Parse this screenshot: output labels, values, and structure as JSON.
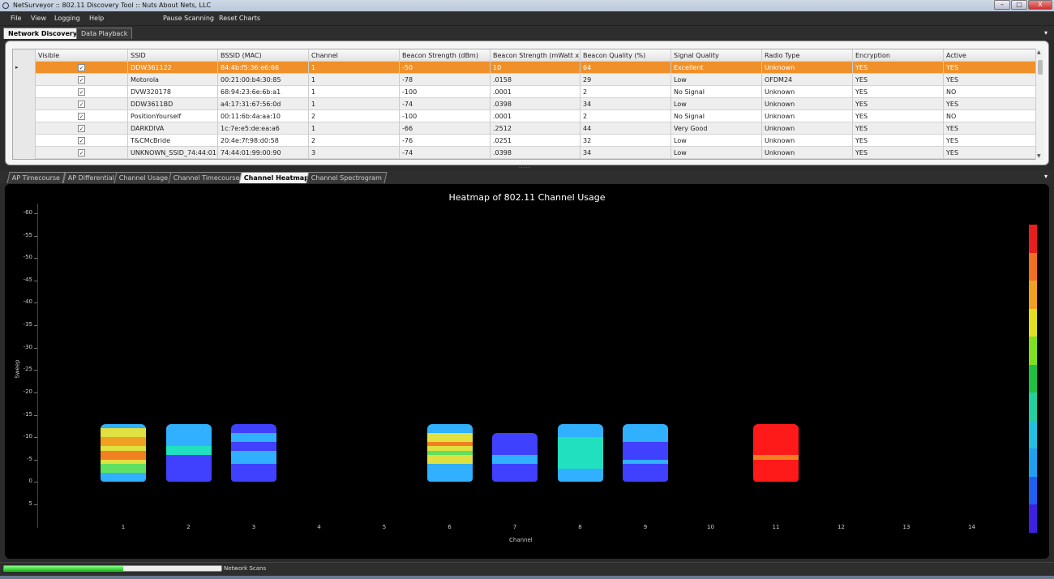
{
  "window": {
    "title": "NetSurveyor :: 802.11 Discovery Tool :: Nuts About Nets, LLC",
    "minimize": "–",
    "maximize": "□",
    "close": "X",
    "icon": "magnifier-icon"
  },
  "menu": {
    "file": "File",
    "view": "View",
    "logging": "Logging",
    "help": "Help",
    "pause": "Pause Scanning",
    "reset": "Reset Charts"
  },
  "top_tabs": [
    {
      "label": "Network Discovery",
      "active": true
    },
    {
      "label": "Data Playback",
      "active": false
    }
  ],
  "grid": {
    "columns": [
      "Visible",
      "SSID",
      "BSSID (MAC)",
      "Channel",
      "Beacon Strength (dBm)",
      "Beacon Strength (mWatt x...",
      "Beacon Quality (%)",
      "Signal Quality",
      "Radio Type",
      "Encryption",
      "Active"
    ],
    "rows": [
      [
        "DDW361122",
        "84:4b:f5:36:e6:66",
        "1",
        "-50",
        "10",
        "64",
        "Excellent",
        "Unknown",
        "YES",
        "YES"
      ],
      [
        "Motorola",
        "00:21:00:b4:30:85",
        "1",
        "-78",
        ".0158",
        "29",
        "Low",
        "OFDM24",
        "YES",
        "YES"
      ],
      [
        "DVW320178",
        "68:94:23:6e:6b:a1",
        "1",
        "-100",
        ".0001",
        "2",
        "No Signal",
        "Unknown",
        "YES",
        "NO"
      ],
      [
        "DDW3611BD",
        "a4:17:31:67:56:0d",
        "1",
        "-74",
        ".0398",
        "34",
        "Low",
        "Unknown",
        "YES",
        "YES"
      ],
      [
        "PositionYourself",
        "00:11:6b:4a:aa:10",
        "2",
        "-100",
        ".0001",
        "2",
        "No Signal",
        "Unknown",
        "YES",
        "NO"
      ],
      [
        "DARKDIVA",
        "1c:7e:e5:de:ea:a6",
        "1",
        "-66",
        ".2512",
        "44",
        "Very Good",
        "Unknown",
        "YES",
        "YES"
      ],
      [
        "T&CMcBride",
        "20:4e:7f:98:d0:58",
        "2",
        "-76",
        ".0251",
        "32",
        "Low",
        "Unknown",
        "YES",
        "YES"
      ],
      [
        "UNKNOWN_SSID_74:44:01:...",
        "74:44:01:99:00:90",
        "3",
        "-74",
        ".0398",
        "34",
        "Low",
        "Unknown",
        "YES",
        "YES"
      ]
    ],
    "check_mark": "✓",
    "selected_marker": "▸"
  },
  "chart_tabs": [
    {
      "label": "AP Timecourse",
      "active": false
    },
    {
      "label": "AP Differential",
      "active": false
    },
    {
      "label": "Channel Usage",
      "active": false
    },
    {
      "label": "Channel Timecourse",
      "active": false
    },
    {
      "label": "Channel Heatmap",
      "active": true
    },
    {
      "label": "Channel Spectrogram",
      "active": false
    }
  ],
  "chart_data": {
    "type": "heatmap",
    "title": "Heatmap of 802.11 Channel Usage",
    "xlabel": "Channel",
    "ylabel": "Sweep",
    "x_ticks": [
      "1",
      "2",
      "3",
      "4",
      "5",
      "6",
      "7",
      "8",
      "9",
      "10",
      "11",
      "12",
      "13",
      "14"
    ],
    "y_ticks": [
      "-60",
      "-55",
      "-50",
      "-45",
      "-40",
      "-35",
      "-30",
      "-25",
      "-20",
      "-15",
      "-10",
      "-5",
      "0",
      "5"
    ],
    "ylim": [
      -62,
      7
    ],
    "colorbar": [
      "#e81e1e",
      "#f07020",
      "#f0a020",
      "#e0e020",
      "#80e020",
      "#20c040",
      "#20d0a0",
      "#20c0e0",
      "#20a0f0",
      "#2060f0",
      "#4020e0"
    ],
    "channels": [
      {
        "channel": 1,
        "sweep_range": [
          -13,
          0
        ],
        "bands": [
          {
            "from": -13,
            "to": -10,
            "color": "#30b0ff"
          },
          {
            "from": -12,
            "to": -10,
            "color": "#e0e040"
          },
          {
            "from": -10,
            "to": -8,
            "color": "#f0a020"
          },
          {
            "from": -8,
            "to": -7,
            "color": "#e0e040"
          },
          {
            "from": -7,
            "to": -5,
            "color": "#f08020"
          },
          {
            "from": -5,
            "to": -4,
            "color": "#e0e040"
          },
          {
            "from": -4,
            "to": -2,
            "color": "#60e060"
          },
          {
            "from": -2,
            "to": 0,
            "color": "#30b0ff"
          }
        ]
      },
      {
        "channel": 2,
        "sweep_range": [
          -13,
          0
        ],
        "bands": [
          {
            "from": -13,
            "to": -8,
            "color": "#30b0ff"
          },
          {
            "from": -8,
            "to": -6,
            "color": "#20e0c0"
          },
          {
            "from": -6,
            "to": -3,
            "color": "#4040ff"
          },
          {
            "from": -3,
            "to": 0,
            "color": "#4040ff"
          }
        ]
      },
      {
        "channel": 3,
        "sweep_range": [
          -13,
          0
        ],
        "bands": [
          {
            "from": -13,
            "to": -11,
            "color": "#4040ff"
          },
          {
            "from": -11,
            "to": -9,
            "color": "#30b0ff"
          },
          {
            "from": -9,
            "to": -7,
            "color": "#4040ff"
          },
          {
            "from": -7,
            "to": -4,
            "color": "#30b0ff"
          },
          {
            "from": -4,
            "to": 0,
            "color": "#4040ff"
          }
        ]
      },
      {
        "channel": 6,
        "sweep_range": [
          -13,
          0
        ],
        "bands": [
          {
            "from": -13,
            "to": -11,
            "color": "#30b0ff"
          },
          {
            "from": -11,
            "to": -9,
            "color": "#e0e040"
          },
          {
            "from": -9,
            "to": -8,
            "color": "#f08020"
          },
          {
            "from": -8,
            "to": -7,
            "color": "#e0e040"
          },
          {
            "from": -7,
            "to": -6,
            "color": "#60e060"
          },
          {
            "from": -6,
            "to": -4,
            "color": "#e0e040"
          },
          {
            "from": -4,
            "to": 0,
            "color": "#30b0ff"
          }
        ]
      },
      {
        "channel": 7,
        "sweep_range": [
          -11,
          0
        ],
        "bands": [
          {
            "from": -11,
            "to": -6,
            "color": "#4040ff"
          },
          {
            "from": -6,
            "to": -4,
            "color": "#30b0ff"
          },
          {
            "from": -4,
            "to": 0,
            "color": "#4040ff"
          }
        ]
      },
      {
        "channel": 8,
        "sweep_range": [
          -13,
          0
        ],
        "bands": [
          {
            "from": -13,
            "to": -10,
            "color": "#30b0ff"
          },
          {
            "from": -10,
            "to": -3,
            "color": "#20e0c0"
          },
          {
            "from": -3,
            "to": 0,
            "color": "#30b0ff"
          }
        ]
      },
      {
        "channel": 9,
        "sweep_range": [
          -13,
          0
        ],
        "bands": [
          {
            "from": -13,
            "to": -9,
            "color": "#30b0ff"
          },
          {
            "from": -9,
            "to": -5,
            "color": "#4040ff"
          },
          {
            "from": -5,
            "to": -4,
            "color": "#30b0ff"
          },
          {
            "from": -4,
            "to": 0,
            "color": "#4040ff"
          }
        ]
      },
      {
        "channel": 11,
        "sweep_range": [
          -13,
          0
        ],
        "bands": [
          {
            "from": -13,
            "to": -6,
            "color": "#ff1a1a"
          },
          {
            "from": -6,
            "to": -5,
            "color": "#f08020"
          },
          {
            "from": -5,
            "to": 0,
            "color": "#ff1a1a"
          }
        ]
      }
    ]
  },
  "statusbar": {
    "progress": 0.55,
    "label": "Network Scans"
  }
}
